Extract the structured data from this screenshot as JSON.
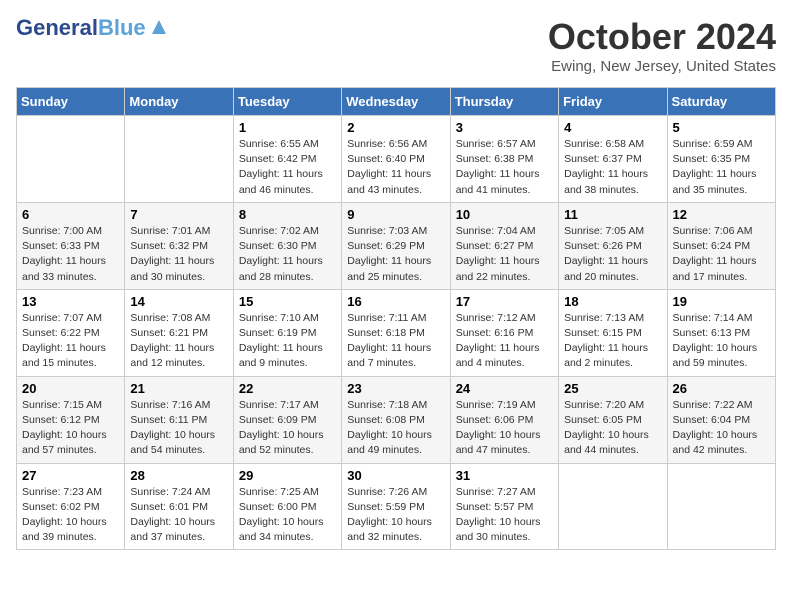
{
  "header": {
    "logo_line1": "General",
    "logo_line2": "Blue",
    "month_title": "October 2024",
    "location": "Ewing, New Jersey, United States"
  },
  "weekdays": [
    "Sunday",
    "Monday",
    "Tuesday",
    "Wednesday",
    "Thursday",
    "Friday",
    "Saturday"
  ],
  "weeks": [
    [
      {
        "day": "",
        "info": ""
      },
      {
        "day": "",
        "info": ""
      },
      {
        "day": "1",
        "info": "Sunrise: 6:55 AM\nSunset: 6:42 PM\nDaylight: 11 hours and 46 minutes."
      },
      {
        "day": "2",
        "info": "Sunrise: 6:56 AM\nSunset: 6:40 PM\nDaylight: 11 hours and 43 minutes."
      },
      {
        "day": "3",
        "info": "Sunrise: 6:57 AM\nSunset: 6:38 PM\nDaylight: 11 hours and 41 minutes."
      },
      {
        "day": "4",
        "info": "Sunrise: 6:58 AM\nSunset: 6:37 PM\nDaylight: 11 hours and 38 minutes."
      },
      {
        "day": "5",
        "info": "Sunrise: 6:59 AM\nSunset: 6:35 PM\nDaylight: 11 hours and 35 minutes."
      }
    ],
    [
      {
        "day": "6",
        "info": "Sunrise: 7:00 AM\nSunset: 6:33 PM\nDaylight: 11 hours and 33 minutes."
      },
      {
        "day": "7",
        "info": "Sunrise: 7:01 AM\nSunset: 6:32 PM\nDaylight: 11 hours and 30 minutes."
      },
      {
        "day": "8",
        "info": "Sunrise: 7:02 AM\nSunset: 6:30 PM\nDaylight: 11 hours and 28 minutes."
      },
      {
        "day": "9",
        "info": "Sunrise: 7:03 AM\nSunset: 6:29 PM\nDaylight: 11 hours and 25 minutes."
      },
      {
        "day": "10",
        "info": "Sunrise: 7:04 AM\nSunset: 6:27 PM\nDaylight: 11 hours and 22 minutes."
      },
      {
        "day": "11",
        "info": "Sunrise: 7:05 AM\nSunset: 6:26 PM\nDaylight: 11 hours and 20 minutes."
      },
      {
        "day": "12",
        "info": "Sunrise: 7:06 AM\nSunset: 6:24 PM\nDaylight: 11 hours and 17 minutes."
      }
    ],
    [
      {
        "day": "13",
        "info": "Sunrise: 7:07 AM\nSunset: 6:22 PM\nDaylight: 11 hours and 15 minutes."
      },
      {
        "day": "14",
        "info": "Sunrise: 7:08 AM\nSunset: 6:21 PM\nDaylight: 11 hours and 12 minutes."
      },
      {
        "day": "15",
        "info": "Sunrise: 7:10 AM\nSunset: 6:19 PM\nDaylight: 11 hours and 9 minutes."
      },
      {
        "day": "16",
        "info": "Sunrise: 7:11 AM\nSunset: 6:18 PM\nDaylight: 11 hours and 7 minutes."
      },
      {
        "day": "17",
        "info": "Sunrise: 7:12 AM\nSunset: 6:16 PM\nDaylight: 11 hours and 4 minutes."
      },
      {
        "day": "18",
        "info": "Sunrise: 7:13 AM\nSunset: 6:15 PM\nDaylight: 11 hours and 2 minutes."
      },
      {
        "day": "19",
        "info": "Sunrise: 7:14 AM\nSunset: 6:13 PM\nDaylight: 10 hours and 59 minutes."
      }
    ],
    [
      {
        "day": "20",
        "info": "Sunrise: 7:15 AM\nSunset: 6:12 PM\nDaylight: 10 hours and 57 minutes."
      },
      {
        "day": "21",
        "info": "Sunrise: 7:16 AM\nSunset: 6:11 PM\nDaylight: 10 hours and 54 minutes."
      },
      {
        "day": "22",
        "info": "Sunrise: 7:17 AM\nSunset: 6:09 PM\nDaylight: 10 hours and 52 minutes."
      },
      {
        "day": "23",
        "info": "Sunrise: 7:18 AM\nSunset: 6:08 PM\nDaylight: 10 hours and 49 minutes."
      },
      {
        "day": "24",
        "info": "Sunrise: 7:19 AM\nSunset: 6:06 PM\nDaylight: 10 hours and 47 minutes."
      },
      {
        "day": "25",
        "info": "Sunrise: 7:20 AM\nSunset: 6:05 PM\nDaylight: 10 hours and 44 minutes."
      },
      {
        "day": "26",
        "info": "Sunrise: 7:22 AM\nSunset: 6:04 PM\nDaylight: 10 hours and 42 minutes."
      }
    ],
    [
      {
        "day": "27",
        "info": "Sunrise: 7:23 AM\nSunset: 6:02 PM\nDaylight: 10 hours and 39 minutes."
      },
      {
        "day": "28",
        "info": "Sunrise: 7:24 AM\nSunset: 6:01 PM\nDaylight: 10 hours and 37 minutes."
      },
      {
        "day": "29",
        "info": "Sunrise: 7:25 AM\nSunset: 6:00 PM\nDaylight: 10 hours and 34 minutes."
      },
      {
        "day": "30",
        "info": "Sunrise: 7:26 AM\nSunset: 5:59 PM\nDaylight: 10 hours and 32 minutes."
      },
      {
        "day": "31",
        "info": "Sunrise: 7:27 AM\nSunset: 5:57 PM\nDaylight: 10 hours and 30 minutes."
      },
      {
        "day": "",
        "info": ""
      },
      {
        "day": "",
        "info": ""
      }
    ]
  ]
}
